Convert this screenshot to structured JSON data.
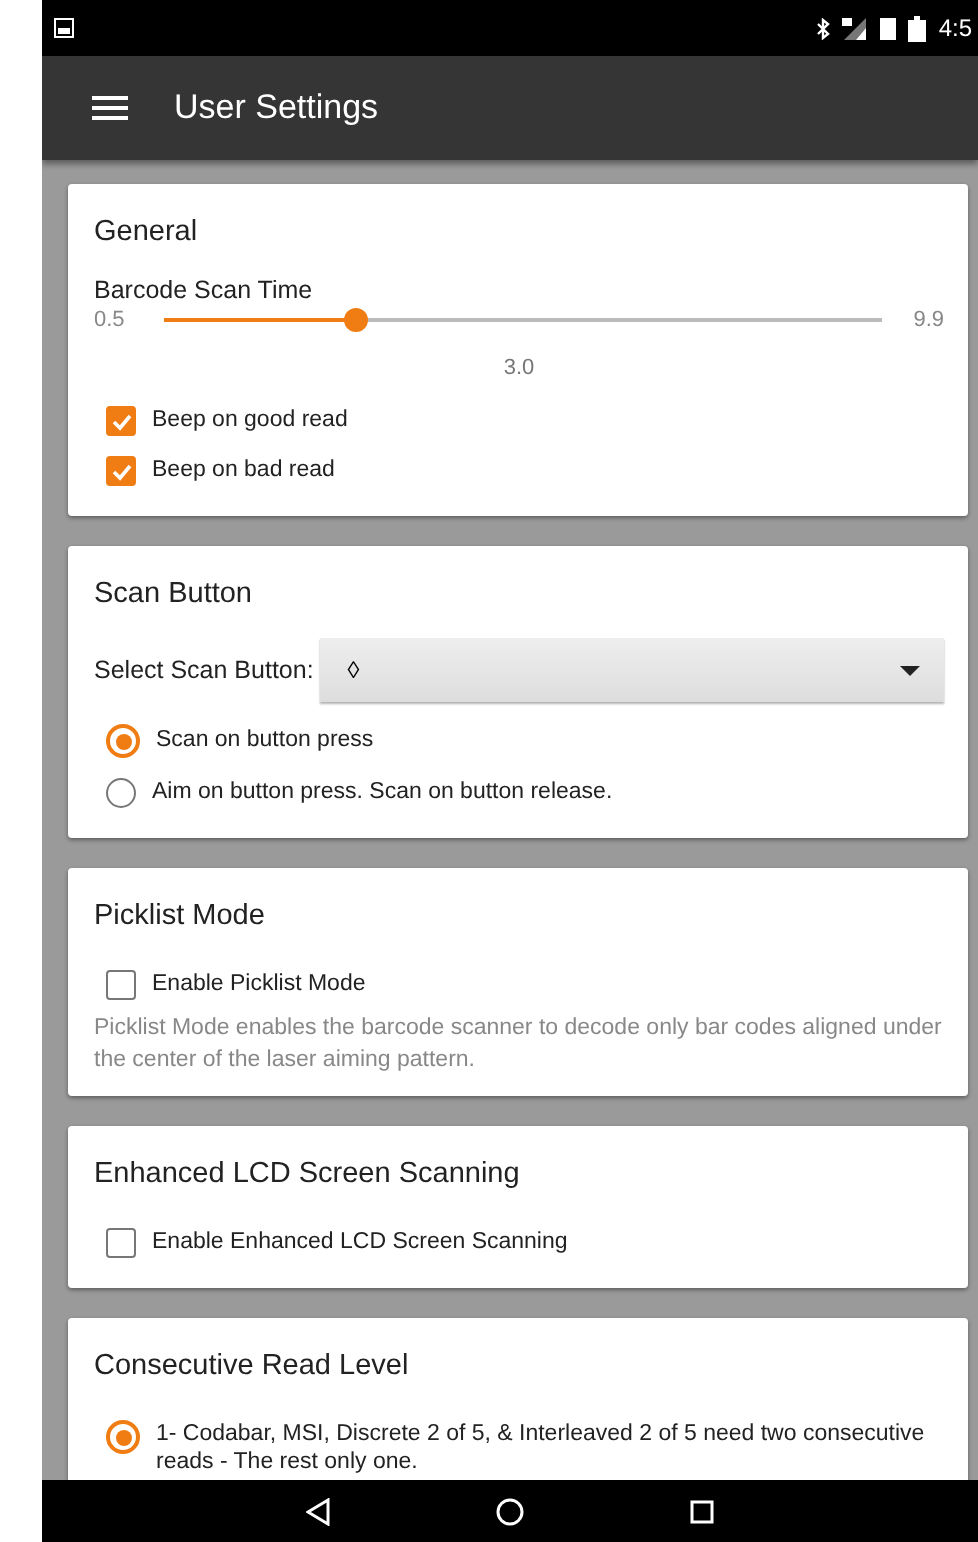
{
  "status_bar": {
    "time": "4:5"
  },
  "app_bar": {
    "title": "User Settings"
  },
  "general": {
    "title": "General",
    "slider": {
      "label": "Barcode Scan Time",
      "min": "0.5",
      "max": "9.9",
      "value": "3.0",
      "level": 0.266
    },
    "checkboxes": [
      {
        "label": "Beep on good read",
        "checked": true
      },
      {
        "label": "Beep on bad read",
        "checked": true
      }
    ]
  },
  "scan_button": {
    "title": "Scan Button",
    "select_label": "Select Scan Button:",
    "select_value": "◊",
    "radios": [
      {
        "label": "Scan on button press",
        "selected": true
      },
      {
        "label": "Aim on button press. Scan on button release.",
        "selected": false
      }
    ]
  },
  "picklist": {
    "title": "Picklist Mode",
    "checkbox": {
      "label": "Enable Picklist Mode",
      "checked": false
    },
    "description": "Picklist Mode enables the barcode scanner to decode only bar codes aligned under the center of the laser aiming pattern."
  },
  "lcd": {
    "title": "Enhanced LCD Screen Scanning",
    "checkbox": {
      "label": "Enable Enhanced LCD Screen Scanning",
      "checked": false
    }
  },
  "consecutive": {
    "title": "Consecutive Read Level",
    "radios": [
      {
        "label": "1- Codabar, MSI, Discrete 2 of 5, & Interleaved 2 of 5 need two consecutive reads - The rest only one.",
        "selected": true
      }
    ]
  }
}
